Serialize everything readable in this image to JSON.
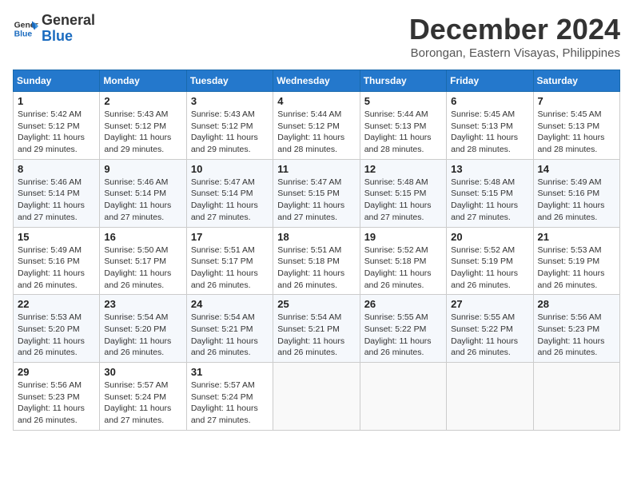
{
  "logo": {
    "line1": "General",
    "line2": "Blue"
  },
  "title": {
    "month": "December 2024",
    "location": "Borongan, Eastern Visayas, Philippines"
  },
  "headers": [
    "Sunday",
    "Monday",
    "Tuesday",
    "Wednesday",
    "Thursday",
    "Friday",
    "Saturday"
  ],
  "weeks": [
    [
      {
        "day": "1",
        "sunrise": "5:42 AM",
        "sunset": "5:12 PM",
        "daylight": "11 hours and 29 minutes."
      },
      {
        "day": "2",
        "sunrise": "5:43 AM",
        "sunset": "5:12 PM",
        "daylight": "11 hours and 29 minutes."
      },
      {
        "day": "3",
        "sunrise": "5:43 AM",
        "sunset": "5:12 PM",
        "daylight": "11 hours and 29 minutes."
      },
      {
        "day": "4",
        "sunrise": "5:44 AM",
        "sunset": "5:12 PM",
        "daylight": "11 hours and 28 minutes."
      },
      {
        "day": "5",
        "sunrise": "5:44 AM",
        "sunset": "5:13 PM",
        "daylight": "11 hours and 28 minutes."
      },
      {
        "day": "6",
        "sunrise": "5:45 AM",
        "sunset": "5:13 PM",
        "daylight": "11 hours and 28 minutes."
      },
      {
        "day": "7",
        "sunrise": "5:45 AM",
        "sunset": "5:13 PM",
        "daylight": "11 hours and 28 minutes."
      }
    ],
    [
      {
        "day": "8",
        "sunrise": "5:46 AM",
        "sunset": "5:14 PM",
        "daylight": "11 hours and 27 minutes."
      },
      {
        "day": "9",
        "sunrise": "5:46 AM",
        "sunset": "5:14 PM",
        "daylight": "11 hours and 27 minutes."
      },
      {
        "day": "10",
        "sunrise": "5:47 AM",
        "sunset": "5:14 PM",
        "daylight": "11 hours and 27 minutes."
      },
      {
        "day": "11",
        "sunrise": "5:47 AM",
        "sunset": "5:15 PM",
        "daylight": "11 hours and 27 minutes."
      },
      {
        "day": "12",
        "sunrise": "5:48 AM",
        "sunset": "5:15 PM",
        "daylight": "11 hours and 27 minutes."
      },
      {
        "day": "13",
        "sunrise": "5:48 AM",
        "sunset": "5:15 PM",
        "daylight": "11 hours and 27 minutes."
      },
      {
        "day": "14",
        "sunrise": "5:49 AM",
        "sunset": "5:16 PM",
        "daylight": "11 hours and 26 minutes."
      }
    ],
    [
      {
        "day": "15",
        "sunrise": "5:49 AM",
        "sunset": "5:16 PM",
        "daylight": "11 hours and 26 minutes."
      },
      {
        "day": "16",
        "sunrise": "5:50 AM",
        "sunset": "5:17 PM",
        "daylight": "11 hours and 26 minutes."
      },
      {
        "day": "17",
        "sunrise": "5:51 AM",
        "sunset": "5:17 PM",
        "daylight": "11 hours and 26 minutes."
      },
      {
        "day": "18",
        "sunrise": "5:51 AM",
        "sunset": "5:18 PM",
        "daylight": "11 hours and 26 minutes."
      },
      {
        "day": "19",
        "sunrise": "5:52 AM",
        "sunset": "5:18 PM",
        "daylight": "11 hours and 26 minutes."
      },
      {
        "day": "20",
        "sunrise": "5:52 AM",
        "sunset": "5:19 PM",
        "daylight": "11 hours and 26 minutes."
      },
      {
        "day": "21",
        "sunrise": "5:53 AM",
        "sunset": "5:19 PM",
        "daylight": "11 hours and 26 minutes."
      }
    ],
    [
      {
        "day": "22",
        "sunrise": "5:53 AM",
        "sunset": "5:20 PM",
        "daylight": "11 hours and 26 minutes."
      },
      {
        "day": "23",
        "sunrise": "5:54 AM",
        "sunset": "5:20 PM",
        "daylight": "11 hours and 26 minutes."
      },
      {
        "day": "24",
        "sunrise": "5:54 AM",
        "sunset": "5:21 PM",
        "daylight": "11 hours and 26 minutes."
      },
      {
        "day": "25",
        "sunrise": "5:54 AM",
        "sunset": "5:21 PM",
        "daylight": "11 hours and 26 minutes."
      },
      {
        "day": "26",
        "sunrise": "5:55 AM",
        "sunset": "5:22 PM",
        "daylight": "11 hours and 26 minutes."
      },
      {
        "day": "27",
        "sunrise": "5:55 AM",
        "sunset": "5:22 PM",
        "daylight": "11 hours and 26 minutes."
      },
      {
        "day": "28",
        "sunrise": "5:56 AM",
        "sunset": "5:23 PM",
        "daylight": "11 hours and 26 minutes."
      }
    ],
    [
      {
        "day": "29",
        "sunrise": "5:56 AM",
        "sunset": "5:23 PM",
        "daylight": "11 hours and 26 minutes."
      },
      {
        "day": "30",
        "sunrise": "5:57 AM",
        "sunset": "5:24 PM",
        "daylight": "11 hours and 27 minutes."
      },
      {
        "day": "31",
        "sunrise": "5:57 AM",
        "sunset": "5:24 PM",
        "daylight": "11 hours and 27 minutes."
      },
      null,
      null,
      null,
      null
    ]
  ]
}
